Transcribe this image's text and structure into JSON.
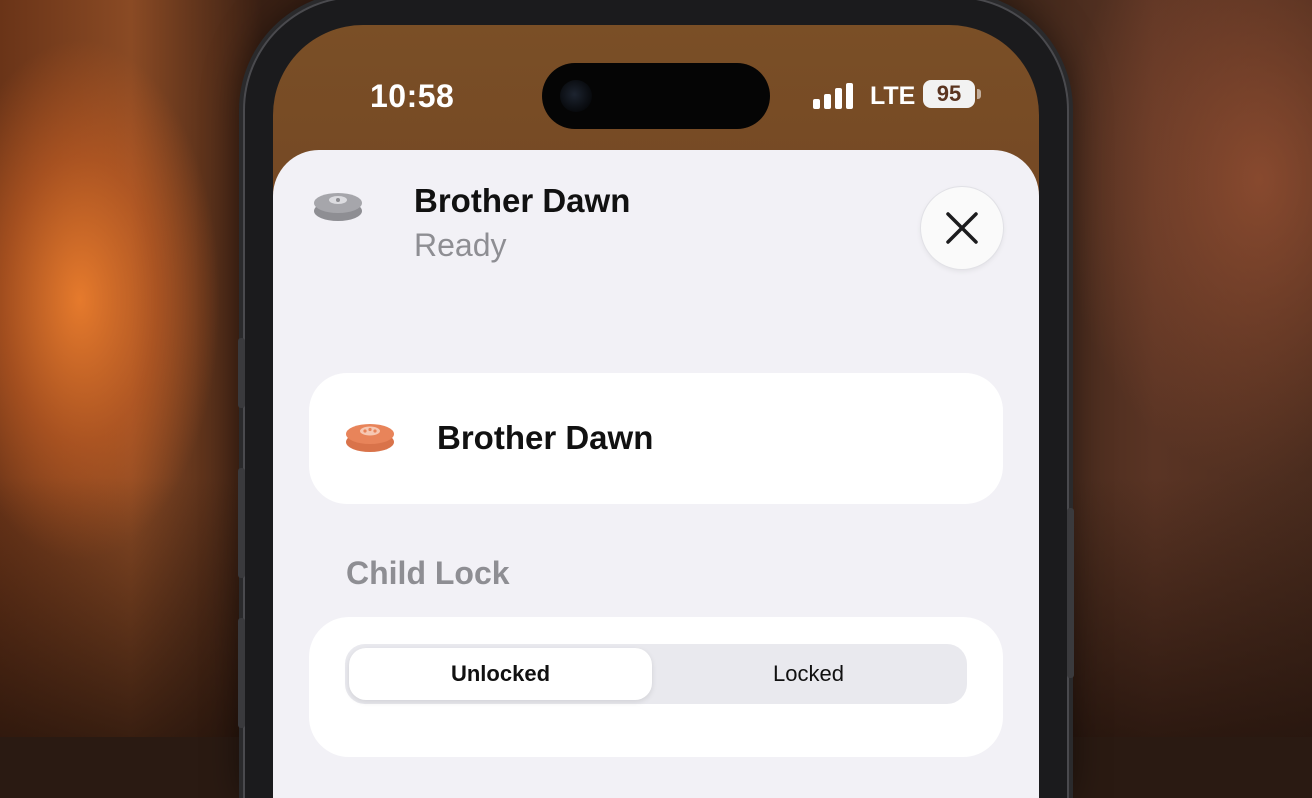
{
  "status_bar": {
    "time": "10:58",
    "network": "LTE",
    "battery": "95"
  },
  "header": {
    "title": "Brother Dawn",
    "subtitle": "Ready",
    "icon": "robot-vacuum-icon",
    "close_icon": "close-icon"
  },
  "accessory_tile": {
    "label": "Brother Dawn",
    "icon": "robot-vacuum-icon",
    "icon_color": "#E8845A"
  },
  "child_lock": {
    "section_label": "Child Lock",
    "options": [
      "Unlocked",
      "Locked"
    ],
    "selected": "Unlocked"
  },
  "colors": {
    "sheet_background": "#F2F1F6",
    "secondary_text": "#8E8E93",
    "accent_orange": "#E8845A"
  }
}
